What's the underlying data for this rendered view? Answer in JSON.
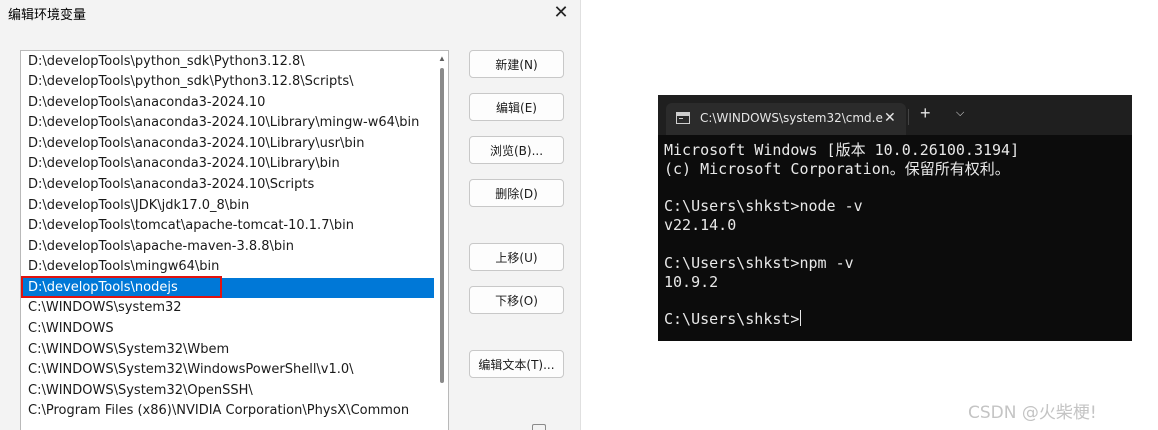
{
  "dialog": {
    "title": "编辑环境变量",
    "close_glyph": "✕",
    "paths": [
      "D:\\developTools\\python_sdk\\Python3.12.8\\",
      "D:\\developTools\\python_sdk\\Python3.12.8\\Scripts\\",
      "D:\\developTools\\anaconda3-2024.10",
      "D:\\developTools\\anaconda3-2024.10\\Library\\mingw-w64\\bin",
      "D:\\developTools\\anaconda3-2024.10\\Library\\usr\\bin",
      "D:\\developTools\\anaconda3-2024.10\\Library\\bin",
      "D:\\developTools\\anaconda3-2024.10\\Scripts",
      "D:\\developTools\\JDK\\jdk17.0_8\\bin",
      "D:\\developTools\\tomcat\\apache-tomcat-10.1.7\\bin",
      "D:\\developTools\\apache-maven-3.8.8\\bin",
      "D:\\developTools\\mingw64\\bin",
      "D:\\developTools\\nodejs",
      "C:\\WINDOWS\\system32",
      "C:\\WINDOWS",
      "C:\\WINDOWS\\System32\\Wbem",
      "C:\\WINDOWS\\System32\\WindowsPowerShell\\v1.0\\",
      "C:\\WINDOWS\\System32\\OpenSSH\\",
      "C:\\Program Files (x86)\\NVIDIA Corporation\\PhysX\\Common"
    ],
    "selected_path": "D:\\developTools\\nodejs",
    "buttons": {
      "new": "新建(N)",
      "edit": "编辑(E)",
      "browse": "浏览(B)...",
      "delete": "删除(D)",
      "move_up": "上移(U)",
      "move_down": "下移(O)",
      "edit_text": "编辑文本(T)..."
    }
  },
  "terminal": {
    "tab_title": "C:\\WINDOWS\\system32\\cmd.e",
    "tab_icon": "terminal-icon",
    "close_glyph": "✕",
    "new_tab_glyph": "+",
    "dropdown_glyph": "⌵",
    "lines": [
      "Microsoft Windows [版本 10.0.26100.3194]",
      "(c) Microsoft Corporation。保留所有权利。",
      "",
      "C:\\Users\\shkst>node -v",
      "v22.14.0",
      "",
      "C:\\Users\\shkst>npm -v",
      "10.9.2",
      "",
      "C:\\Users\\shkst>"
    ]
  },
  "watermark": "CSDN @火柴梗!",
  "colors": {
    "selection": "#0078d7",
    "highlight_outline": "#e1130f",
    "terminal_bg": "#0c0c0c"
  }
}
